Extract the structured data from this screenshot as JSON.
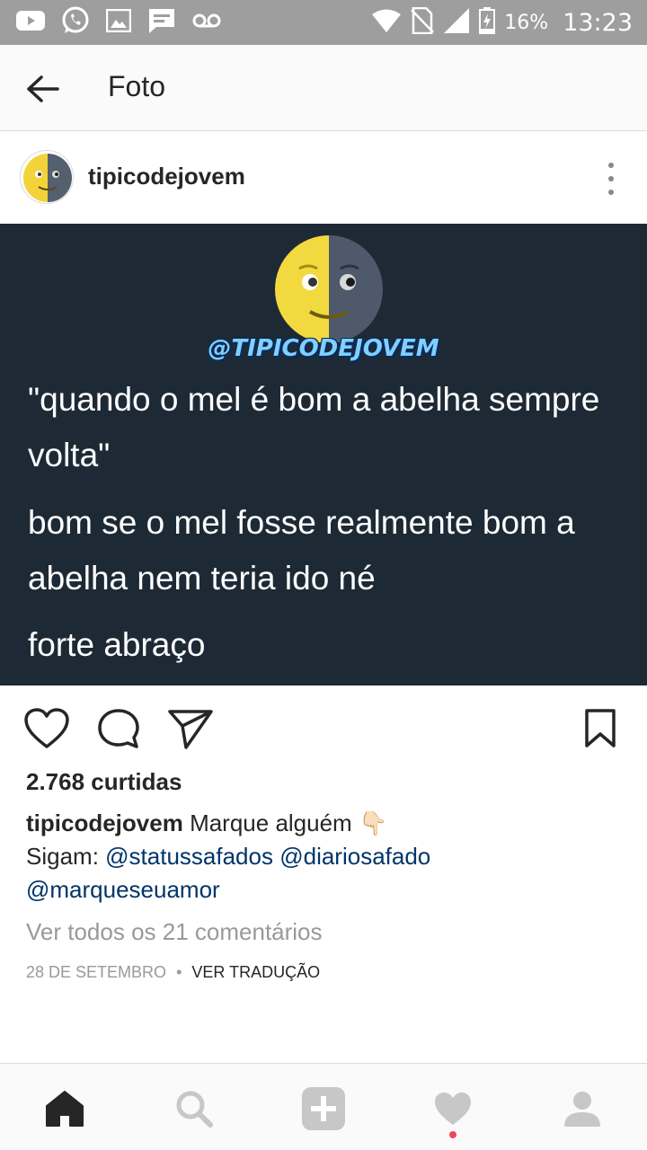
{
  "status_bar": {
    "battery_percent": "16%",
    "time": "13:23",
    "left_icons": [
      "youtube-icon",
      "whatsapp-icon",
      "gallery-icon",
      "message-icon",
      "voicemail-icon"
    ],
    "right_icons": [
      "wifi-icon",
      "no-sim-icon",
      "signal-icon",
      "battery-charging-icon"
    ]
  },
  "toolbar": {
    "title": "Foto",
    "back_icon": "arrow-left-icon"
  },
  "post": {
    "username": "tipicodejovem",
    "avatar_icon": "half-moon-face-icon",
    "more_icon": "more-vertical-icon",
    "image": {
      "watermark": "@TIPICODEJOVEM",
      "quote_line_1": "\"quando o mel é bom a abelha sempre volta\"",
      "quote_line_2": "bom se o mel fosse realmente bom a abelha nem teria ido né",
      "quote_line_3": "forte abraço",
      "background_color": "#1d2a36"
    },
    "actions": {
      "like_icon": "heart-icon",
      "comment_icon": "comment-icon",
      "share_icon": "send-icon",
      "save_icon": "bookmark-icon"
    },
    "likes": "2.768 curtidas",
    "caption": {
      "user": "tipicodejovem",
      "text": "Marque alguém",
      "emoji": "👇🏻",
      "follow_label": "Sigam:",
      "mention_1": "@statussafados",
      "mention_2": "@diariosafado",
      "mention_3": "@marqueseuamor"
    },
    "view_comments": "Ver todos os 21 comentários",
    "date": "28 DE SETEMBRO",
    "separator": "•",
    "translate": "VER TRADUÇÃO"
  },
  "bottom_nav": {
    "items": [
      "home-icon",
      "search-icon",
      "add-icon",
      "activity-heart-icon",
      "profile-icon"
    ],
    "accent_color": "#ed4956"
  }
}
